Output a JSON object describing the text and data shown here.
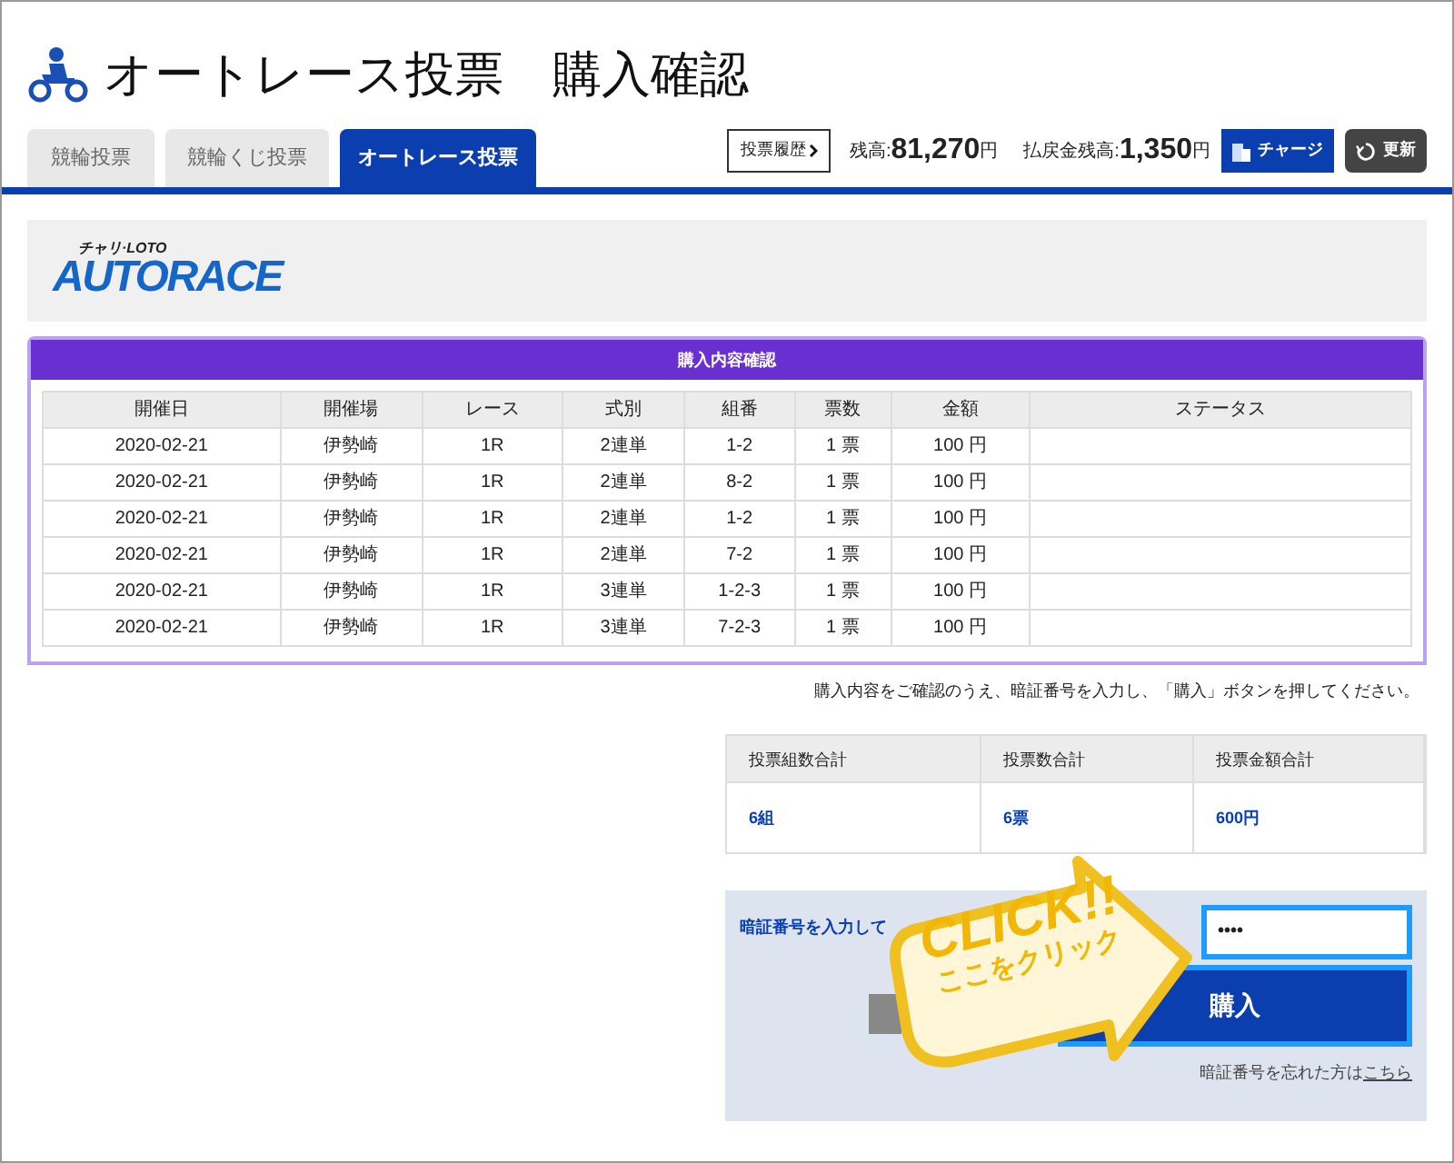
{
  "header": {
    "title": "オートレース投票　購入確認"
  },
  "tabs": [
    {
      "label": "競輪投票",
      "selected": false
    },
    {
      "label": "競輪くじ投票",
      "selected": false
    },
    {
      "label": "オートレース投票",
      "selected": true
    }
  ],
  "account": {
    "history_button": "投票履歴",
    "balance_label": "残高:",
    "balance": "81,270",
    "balance_unit": "円",
    "refund_label": "払戻金残高:",
    "refund": "1,350",
    "refund_unit": "円",
    "charge_button": "チャージ",
    "refresh_button": "更新"
  },
  "logo": {
    "top": "チャリ·LOTO",
    "main": "AUTORACE"
  },
  "confirm": {
    "title": "購入内容確認",
    "columns": [
      "開催日",
      "開催場",
      "レース",
      "式別",
      "組番",
      "票数",
      "金額",
      "ステータス"
    ],
    "rows": [
      [
        "2020-02-21",
        "伊勢崎",
        "1R",
        "2連単",
        "1-2",
        "1 票",
        "100 円",
        ""
      ],
      [
        "2020-02-21",
        "伊勢崎",
        "1R",
        "2連単",
        "8-2",
        "1 票",
        "100 円",
        ""
      ],
      [
        "2020-02-21",
        "伊勢崎",
        "1R",
        "2連単",
        "1-2",
        "1 票",
        "100 円",
        ""
      ],
      [
        "2020-02-21",
        "伊勢崎",
        "1R",
        "2連単",
        "7-2",
        "1 票",
        "100 円",
        ""
      ],
      [
        "2020-02-21",
        "伊勢崎",
        "1R",
        "3連単",
        "1-2-3",
        "1 票",
        "100 円",
        ""
      ],
      [
        "2020-02-21",
        "伊勢崎",
        "1R",
        "3連単",
        "7-2-3",
        "1 票",
        "100 円",
        ""
      ]
    ]
  },
  "instruction": "購入内容をご確認のうえ、暗証番号を入力し、「購入」ボタンを押してください。",
  "summary": {
    "columns": [
      "投票組数合計",
      "投票数合計",
      "投票金額合計"
    ],
    "values": [
      "6組",
      "6票",
      "600円"
    ]
  },
  "pin": {
    "label": "暗証番号を入力して",
    "value": "••••",
    "buy_button": "購入",
    "forgot_text": "暗証番号を忘れた方は",
    "forgot_link": "こちら"
  },
  "callout": {
    "title": "CLICK!!",
    "subtitle": "ここをクリック"
  }
}
